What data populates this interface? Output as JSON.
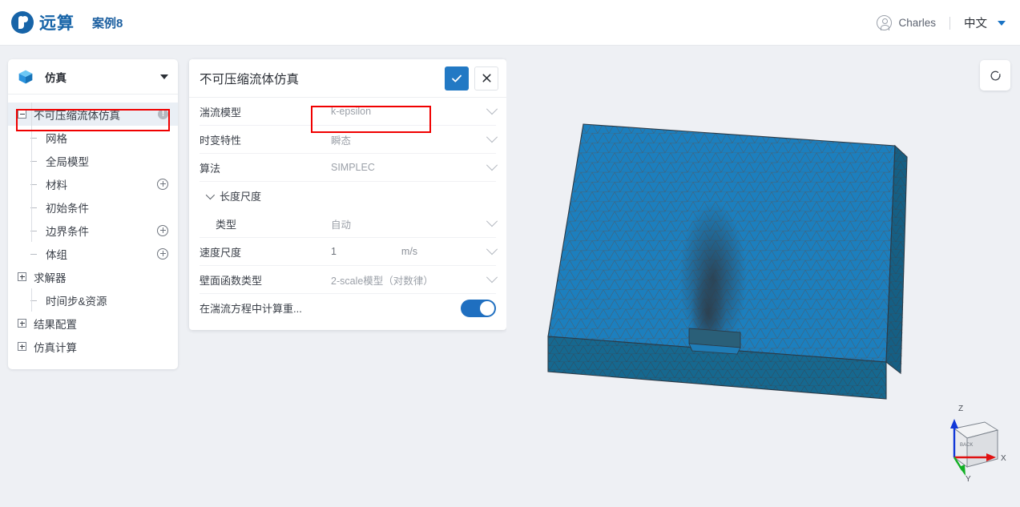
{
  "header": {
    "logo_text": "远算",
    "logo_icon": "yuansuan-logo-icon",
    "doc_title": "案例8",
    "user_name": "Charles",
    "user_icon": "user-avatar-icon",
    "language": "中文",
    "language_caret_icon": "chevron-down-icon"
  },
  "sidebar": {
    "header": {
      "label": "仿真",
      "icon": "cube-icon",
      "caret_icon": "chevron-down-icon"
    },
    "items": [
      {
        "label": "不可压缩流体仿真",
        "depth": 0,
        "toggle": "minus",
        "badge": "!",
        "selected": true,
        "highlighted": true
      },
      {
        "label": "网格",
        "depth": 1,
        "toggle": "dash",
        "badge": "",
        "selected": false
      },
      {
        "label": "全局模型",
        "depth": 1,
        "toggle": "dash",
        "badge": "",
        "selected": false
      },
      {
        "label": "材料",
        "depth": 1,
        "toggle": "dash",
        "badge": "plus",
        "selected": false
      },
      {
        "label": "初始条件",
        "depth": 1,
        "toggle": "dash",
        "badge": "",
        "selected": false
      },
      {
        "label": "边界条件",
        "depth": 1,
        "toggle": "dash",
        "badge": "plus",
        "selected": false
      },
      {
        "label": "体组",
        "depth": 1,
        "toggle": "dash",
        "badge": "plus",
        "selected": false
      },
      {
        "label": "求解器",
        "depth": 0,
        "toggle": "plus",
        "badge": "",
        "selected": false
      },
      {
        "label": "时间步&资源",
        "depth": 1,
        "toggle": "dash",
        "badge": "",
        "selected": false
      },
      {
        "label": "结果配置",
        "depth": 0,
        "toggle": "plus",
        "badge": "",
        "selected": false
      },
      {
        "label": "仿真计算",
        "depth": 0,
        "toggle": "plus",
        "badge": "",
        "selected": false
      }
    ]
  },
  "panel": {
    "title": "不可压缩流体仿真",
    "confirm_icon": "check-icon",
    "cancel_icon": "close-icon",
    "fields": [
      {
        "label": "湍流模型",
        "value": "k-epsilon",
        "control": "select",
        "unit": "",
        "highlighted": true
      },
      {
        "label": "时变特性",
        "value": "瞬态",
        "control": "select",
        "unit": ""
      },
      {
        "label": "算法",
        "value": "SIMPLEC",
        "control": "select",
        "unit": ""
      },
      {
        "label": "长度尺度",
        "value": "",
        "control": "group",
        "unit": ""
      },
      {
        "label": "类型",
        "value": "自动",
        "control": "select",
        "unit": "",
        "indent": true
      },
      {
        "label": "速度尺度",
        "value": "1",
        "control": "input",
        "unit": "m/s"
      },
      {
        "label": "壁面函数类型",
        "value": "2-scale模型（对数律）",
        "control": "select",
        "unit": ""
      },
      {
        "label": "在湍流方程中计算重...",
        "value": "on",
        "control": "toggle",
        "unit": ""
      }
    ]
  },
  "viewport": {
    "reset_icon": "reset-view-icon",
    "axis_labels": {
      "x": "X",
      "y": "Y",
      "z": "Z",
      "face": "BACK"
    },
    "model_name": "cfd-mesh-box",
    "mesh_color": "#1c7fbe",
    "mesh_line_color": "#44505c"
  },
  "colors": {
    "accent": "#1f6fc0",
    "brand": "#1764a8",
    "highlight": "#f00000",
    "page_bg": "#eef0f4"
  }
}
